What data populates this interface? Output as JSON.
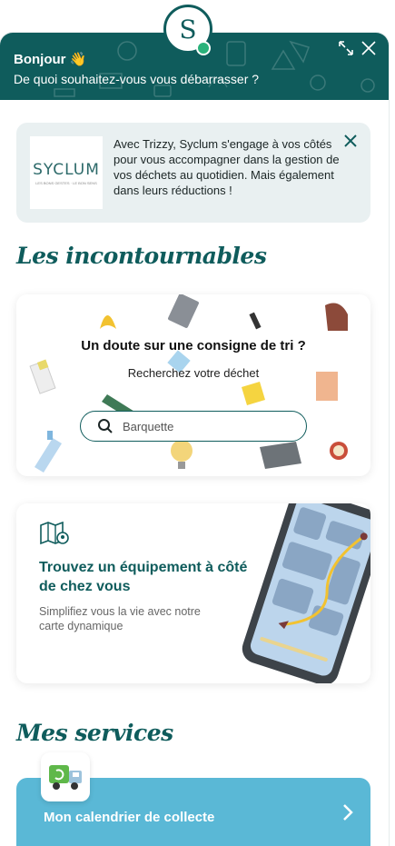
{
  "header": {
    "greeting": "Bonjour",
    "wave_emoji": "👋",
    "subtitle": "De quoi souhaitez-vous vous débarrasser ?",
    "expand_icon": "expand-icon",
    "close_icon": "close-icon",
    "background_color": "#0f5c5c"
  },
  "logo": {
    "letter": "S",
    "status_color": "#2ab27b"
  },
  "info_card": {
    "partner_name": "SYCLUM",
    "partner_tagline": "LES BONS GESTES · LE BON SENS",
    "text": "Avec Trizzy, Syclum s'engage à vos côtés pour vous accompagner dans la gestion de vos déchets au quotidien. Mais également dans leurs réductions !"
  },
  "sections": {
    "essentials": "Les incontournables",
    "services": "Mes services"
  },
  "search_card": {
    "title": "Un doute sur une consigne de tri ?",
    "subtitle": "Recherchez votre déchet",
    "placeholder": "Barquette",
    "icon": "search-icon"
  },
  "map_card": {
    "title": "Trouvez un équipement à côté de chez vous",
    "subtitle": "Simplifiez vous la vie avec notre carte dynamique",
    "icon": "map-pin-icon"
  },
  "services": {
    "calendar_label": "Mon calendrier de collecte",
    "icon": "garbage-truck-icon",
    "accent_color": "#5ab8d6"
  }
}
